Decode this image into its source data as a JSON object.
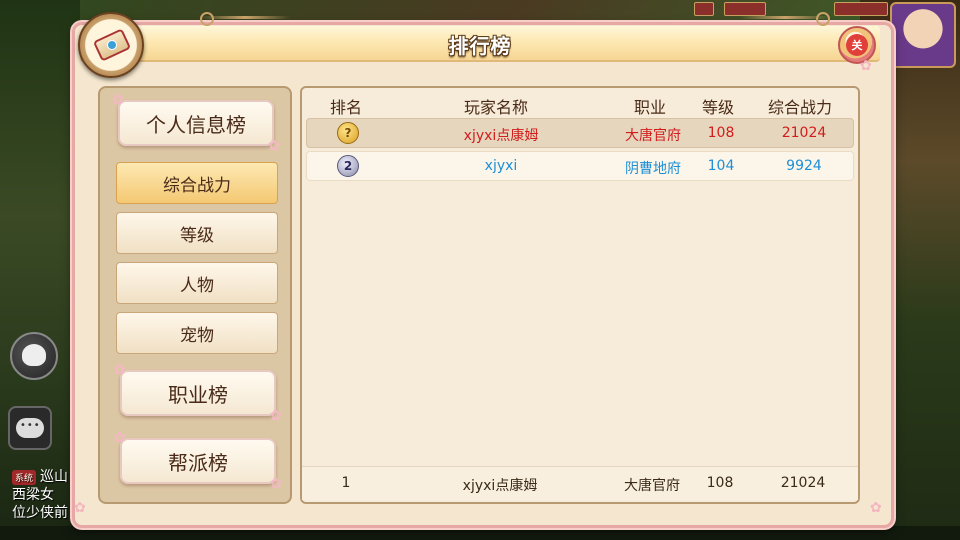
{
  "window": {
    "title": "排行榜",
    "close_label": "关"
  },
  "sidebar": {
    "personal_tab": "个人信息榜",
    "sub_items": [
      {
        "label": "综合战力",
        "active": true
      },
      {
        "label": "等级",
        "active": false
      },
      {
        "label": "人物",
        "active": false
      },
      {
        "label": "宠物",
        "active": false
      }
    ],
    "job_tab": "职业榜",
    "guild_tab": "帮派榜"
  },
  "table": {
    "headers": {
      "rank": "排名",
      "player": "玩家名称",
      "job": "职业",
      "level": "等级",
      "power": "综合战力"
    },
    "rows": [
      {
        "rank": "1",
        "rank_icon": "gold-medal-icon",
        "player": "xjyxi点康姆",
        "job": "大唐官府",
        "level": "108",
        "power": "21024",
        "color": "#d21c1c"
      },
      {
        "rank": "2",
        "rank_icon": "silver-medal-icon",
        "player": "xjyxi",
        "job": "阴曹地府",
        "level": "104",
        "power": "9924",
        "color": "#1e8fd6"
      }
    ],
    "self_row": {
      "rank": "1",
      "player": "xjyxi点康姆",
      "job": "大唐官府",
      "level": "108",
      "power": "21024"
    }
  },
  "hud": {
    "sys_tag": "系统",
    "sys_line1": "巡山",
    "sys_line2": "西梁女",
    "sys_line3": "位少侠前"
  }
}
